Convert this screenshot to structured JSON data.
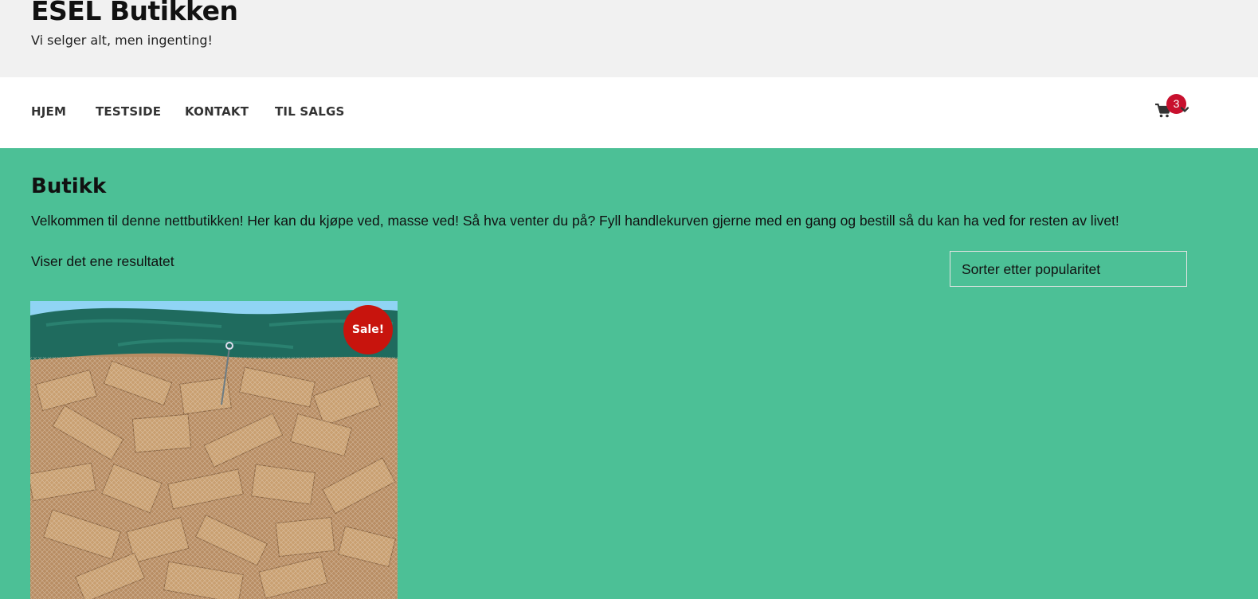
{
  "site": {
    "title": "ESEL Butikken",
    "tagline": "Vi selger alt, men ingenting!"
  },
  "nav": {
    "items": [
      {
        "label": "HJEM"
      },
      {
        "label": "TESTSIDE"
      },
      {
        "label": "KONTAKT"
      },
      {
        "label": "TIL SALGS"
      }
    ]
  },
  "cart": {
    "count": "3",
    "icon": "shopping-cart-icon",
    "dropdown_icon": "chevron-down-icon",
    "badge_color": "#c8102e"
  },
  "shop": {
    "heading": "Butikk",
    "intro": "Velkommen til denne nettbutikken! Her kan du kjøpe ved, masse ved! Så hva venter du på? Fyll handlekurven gjerne med en gang og bestill så du kan ha ved for resten av livet!",
    "result_count": "Viser det ene resultatet",
    "sort_selected": "Sorter etter popularitet"
  },
  "product": {
    "sale_badge": "Sale!",
    "sale_color": "#c8140d"
  },
  "colors": {
    "page_background": "#4cc096",
    "header_background": "#f1f1f1",
    "nav_background": "#ffffff"
  }
}
